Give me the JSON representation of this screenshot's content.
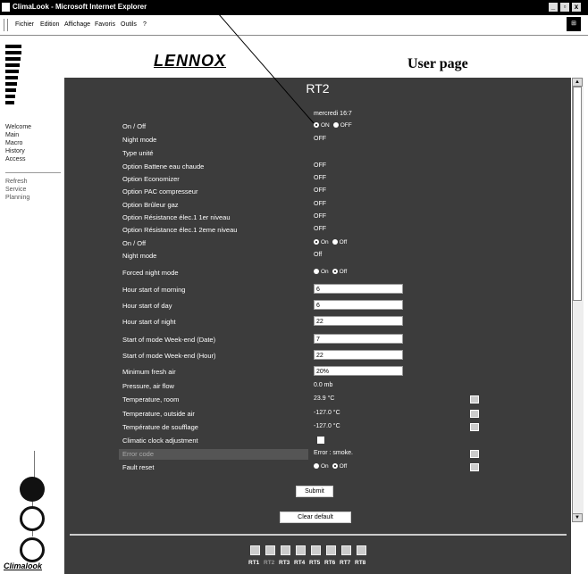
{
  "window": {
    "title": "ClimaLook - Microsoft Internet Explorer",
    "buttons": [
      "_",
      "▫",
      "x"
    ]
  },
  "menu": [
    "Fichier",
    "Edition",
    "Affichage",
    "Favoris",
    "Outils",
    "?"
  ],
  "header": {
    "brand": "LENNOX",
    "page": "User page"
  },
  "nav": {
    "primary": [
      "Welcome",
      "Main",
      "Macro",
      "History",
      "Access"
    ],
    "secondary": [
      "Refresh",
      "Service",
      "Planning"
    ]
  },
  "unit_title": "RT2",
  "datetime": "mercredi 16:7",
  "rows": [
    {
      "label": "On / Off",
      "type": "radio",
      "options": [
        "ON",
        "OFF"
      ],
      "selected": 0
    },
    {
      "label": "Night mode",
      "type": "text",
      "value": "OFF"
    },
    {
      "label": "Type unité",
      "type": "text",
      "value": ""
    },
    {
      "label": "Option Battene eau chaude",
      "type": "text",
      "value": "OFF"
    },
    {
      "label": "Option Economizer",
      "type": "text",
      "value": "OFF"
    },
    {
      "label": "Option PAC compresseur",
      "type": "text",
      "value": "OFF"
    },
    {
      "label": "Option Brûleur gaz",
      "type": "text",
      "value": "OFF"
    },
    {
      "label": "Option Résistance élec.1 1er niveau",
      "type": "text",
      "value": "OFF"
    },
    {
      "label": "Option Résistance élec.1 2eme niveau",
      "type": "text",
      "value": "OFF"
    },
    {
      "label": "On / Off",
      "type": "radio",
      "options": [
        "On",
        "Off"
      ],
      "selected": 0
    },
    {
      "label": "Night mode",
      "type": "text",
      "value": "Off"
    },
    {
      "label": "Forced night mode",
      "type": "radio",
      "options": [
        "On",
        "Off"
      ],
      "selected": 1
    },
    {
      "label": "Hour start of morning",
      "type": "input",
      "value": "6"
    },
    {
      "label": "Hour start of day",
      "type": "input",
      "value": "6"
    },
    {
      "label": "Hour start of night",
      "type": "input",
      "value": "22"
    },
    {
      "label": "Start of mode Week-end (Date)",
      "type": "input",
      "value": "7"
    },
    {
      "label": "Start of mode Week-end (Hour)",
      "type": "input",
      "value": "22"
    },
    {
      "label": "Minimum fresh air",
      "type": "input",
      "value": "20%"
    },
    {
      "label": "Pressure, air flow",
      "type": "text",
      "value": "0.0 mb"
    },
    {
      "label": "Temperature, room",
      "type": "text",
      "value": "23.9 °C",
      "graph": true
    },
    {
      "label": "Temperature, outside air",
      "type": "text",
      "value": "-127.0 °C",
      "graph": true
    },
    {
      "label": "Température de soufflage",
      "type": "text",
      "value": "-127.0 °C",
      "graph": true
    },
    {
      "label": "Climatic clock adjustment",
      "type": "checkbox",
      "checked": false
    },
    {
      "label": "Error code",
      "type": "text",
      "value": "Error : smoke.",
      "graph": true,
      "dim": true
    },
    {
      "label": "Fault reset",
      "type": "radio",
      "options": [
        "On",
        "Off"
      ],
      "selected": 1,
      "graph": true
    }
  ],
  "buttons": {
    "submit": "Submit",
    "clear": "Clear default"
  },
  "units": [
    "RT1",
    "RT2",
    "RT3",
    "RT4",
    "RT5",
    "RT6",
    "RT7",
    "RT8"
  ],
  "active_unit": "RT2",
  "footer_logo": "Climalook"
}
